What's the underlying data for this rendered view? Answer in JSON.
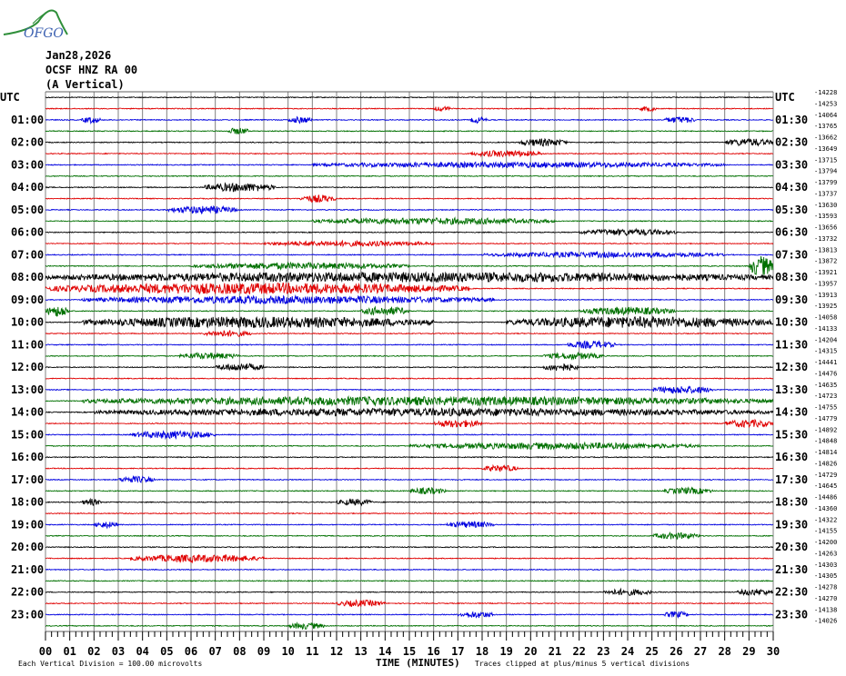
{
  "logo": {
    "text": "OFGO",
    "colors": {
      "hill": "#2f8f3a",
      "text": "#3a5fb0"
    }
  },
  "header": {
    "date": "Jan28,2026",
    "station": "OCSF HNZ RA 00",
    "component": "(A Vertical)",
    "tz_left": "UTC",
    "tz_right": "UTC"
  },
  "footer": {
    "scale": "Each Vertical Division = 100.00 microvolts",
    "xlabel": "TIME (MINUTES)",
    "note": "Traces clipped at plus/minus 5 vertical divisions"
  },
  "chart_data": {
    "type": "line",
    "subtype": "helicorder",
    "x_ticks": [
      "00",
      "01",
      "02",
      "03",
      "04",
      "05",
      "06",
      "07",
      "08",
      "09",
      "10",
      "11",
      "12",
      "13",
      "14",
      "15",
      "16",
      "17",
      "18",
      "19",
      "20",
      "21",
      "22",
      "23",
      "24",
      "25",
      "26",
      "27",
      "28",
      "29",
      "30"
    ],
    "xlim": [
      0,
      30
    ],
    "minor_ticks_per_minute": 4,
    "trace_color_cycle": [
      "#000000",
      "#e00000",
      "#0000e0",
      "#007000"
    ],
    "row_count": 48,
    "left_labels": [
      "UTC",
      "01:00",
      "02:00",
      "03:00",
      "04:00",
      "05:00",
      "06:00",
      "07:00",
      "08:00",
      "09:00",
      "10:00",
      "11:00",
      "12:00",
      "13:00",
      "14:00",
      "15:00",
      "16:00",
      "17:00",
      "18:00",
      "19:00",
      "20:00",
      "21:00",
      "22:00",
      "23:00"
    ],
    "right_labels": [
      "UTC",
      "01:30",
      "02:30",
      "03:30",
      "04:30",
      "05:30",
      "06:30",
      "07:30",
      "08:30",
      "09:30",
      "10:30",
      "11:30",
      "12:30",
      "13:30",
      "14:30",
      "15:30",
      "16:30",
      "17:30",
      "18:30",
      "19:30",
      "20:30",
      "21:30",
      "22:30",
      "23:30"
    ],
    "offsets": [
      "-14228",
      "-14253",
      "-14064",
      "-13765",
      "-13662",
      "-13649",
      "-13715",
      "-13794",
      "-13799",
      "-13737",
      "-13630",
      "-13593",
      "-13656",
      "-13732",
      "-13813",
      "-13872",
      "-13921",
      "-13957",
      "-13913",
      "-13925",
      "-14058",
      "-14133",
      "-14204",
      "-14315",
      "-14441",
      "-14476",
      "-14635",
      "-14723",
      "-14755",
      "-14779",
      "-14892",
      "-14848",
      "-14814",
      "-14826",
      "-14729",
      "-14645",
      "-14486",
      "-14360",
      "-14322",
      "-14155",
      "-14200",
      "-14263",
      "-14303",
      "-14305",
      "-14278",
      "-14270",
      "-14138",
      "-14026"
    ],
    "events": [
      {
        "row": 1,
        "start": 16.0,
        "end": 16.7,
        "amp": 0.25
      },
      {
        "row": 1,
        "start": 24.5,
        "end": 25.2,
        "amp": 0.25
      },
      {
        "row": 2,
        "start": 1.5,
        "end": 2.3,
        "amp": 0.3
      },
      {
        "row": 2,
        "start": 10.0,
        "end": 11.0,
        "amp": 0.3
      },
      {
        "row": 2,
        "start": 17.5,
        "end": 18.2,
        "amp": 0.3
      },
      {
        "row": 2,
        "start": 25.5,
        "end": 26.8,
        "amp": 0.3
      },
      {
        "row": 3,
        "start": 7.5,
        "end": 8.4,
        "amp": 0.3
      },
      {
        "row": 4,
        "start": 19.5,
        "end": 21.5,
        "amp": 0.35
      },
      {
        "row": 4,
        "start": 28.0,
        "end": 30.0,
        "amp": 0.35
      },
      {
        "row": 5,
        "start": 17.5,
        "end": 20.5,
        "amp": 0.3
      },
      {
        "row": 6,
        "start": 11.0,
        "end": 28.0,
        "amp": 0.25
      },
      {
        "row": 8,
        "start": 6.5,
        "end": 9.5,
        "amp": 0.4
      },
      {
        "row": 9,
        "start": 10.5,
        "end": 12.0,
        "amp": 0.35
      },
      {
        "row": 10,
        "start": 5.0,
        "end": 8.0,
        "amp": 0.35
      },
      {
        "row": 11,
        "start": 11.0,
        "end": 21.0,
        "amp": 0.3
      },
      {
        "row": 12,
        "start": 22.0,
        "end": 26.0,
        "amp": 0.3
      },
      {
        "row": 13,
        "start": 9.0,
        "end": 16.0,
        "amp": 0.25
      },
      {
        "row": 14,
        "start": 18.0,
        "end": 28.0,
        "amp": 0.25
      },
      {
        "row": 15,
        "start": 6.0,
        "end": 15.0,
        "amp": 0.3
      },
      {
        "row": 15,
        "start": 29.0,
        "end": 30.0,
        "amp": 0.9
      },
      {
        "row": 16,
        "start": 0.0,
        "end": 30.0,
        "amp": 0.45
      },
      {
        "row": 17,
        "start": 0.0,
        "end": 17.5,
        "amp": 0.5
      },
      {
        "row": 18,
        "start": 1.5,
        "end": 18.5,
        "amp": 0.35
      },
      {
        "row": 19,
        "start": 0.0,
        "end": 1.0,
        "amp": 0.5
      },
      {
        "row": 19,
        "start": 13.0,
        "end": 15.0,
        "amp": 0.4
      },
      {
        "row": 19,
        "start": 22.0,
        "end": 26.0,
        "amp": 0.35
      },
      {
        "row": 20,
        "start": 1.5,
        "end": 16.0,
        "amp": 0.5
      },
      {
        "row": 20,
        "start": 19.0,
        "end": 30.0,
        "amp": 0.5
      },
      {
        "row": 21,
        "start": 6.5,
        "end": 8.5,
        "amp": 0.3
      },
      {
        "row": 22,
        "start": 21.5,
        "end": 23.5,
        "amp": 0.35
      },
      {
        "row": 23,
        "start": 5.5,
        "end": 8.0,
        "amp": 0.3
      },
      {
        "row": 23,
        "start": 20.5,
        "end": 23.0,
        "amp": 0.3
      },
      {
        "row": 24,
        "start": 7.0,
        "end": 9.0,
        "amp": 0.35
      },
      {
        "row": 24,
        "start": 20.5,
        "end": 22.0,
        "amp": 0.35
      },
      {
        "row": 26,
        "start": 25.0,
        "end": 27.5,
        "amp": 0.35
      },
      {
        "row": 27,
        "start": 1.5,
        "end": 30.0,
        "amp": 0.4
      },
      {
        "row": 28,
        "start": 2.0,
        "end": 30.0,
        "amp": 0.35
      },
      {
        "row": 29,
        "start": 16.0,
        "end": 18.0,
        "amp": 0.35
      },
      {
        "row": 29,
        "start": 28.0,
        "end": 30.0,
        "amp": 0.35
      },
      {
        "row": 30,
        "start": 3.5,
        "end": 7.0,
        "amp": 0.35
      },
      {
        "row": 31,
        "start": 15.0,
        "end": 27.0,
        "amp": 0.3
      },
      {
        "row": 33,
        "start": 18.0,
        "end": 19.5,
        "amp": 0.3
      },
      {
        "row": 34,
        "start": 3.0,
        "end": 4.5,
        "amp": 0.3
      },
      {
        "row": 35,
        "start": 15.0,
        "end": 16.5,
        "amp": 0.3
      },
      {
        "row": 35,
        "start": 25.5,
        "end": 27.5,
        "amp": 0.3
      },
      {
        "row": 36,
        "start": 1.5,
        "end": 2.3,
        "amp": 0.3
      },
      {
        "row": 36,
        "start": 12.0,
        "end": 13.5,
        "amp": 0.3
      },
      {
        "row": 38,
        "start": 2.0,
        "end": 3.0,
        "amp": 0.3
      },
      {
        "row": 38,
        "start": 16.5,
        "end": 18.5,
        "amp": 0.3
      },
      {
        "row": 39,
        "start": 25.0,
        "end": 27.0,
        "amp": 0.3
      },
      {
        "row": 41,
        "start": 3.5,
        "end": 9.0,
        "amp": 0.35
      },
      {
        "row": 44,
        "start": 23.0,
        "end": 25.0,
        "amp": 0.3
      },
      {
        "row": 44,
        "start": 28.5,
        "end": 30.0,
        "amp": 0.3
      },
      {
        "row": 45,
        "start": 12.0,
        "end": 14.0,
        "amp": 0.3
      },
      {
        "row": 46,
        "start": 17.0,
        "end": 18.5,
        "amp": 0.3
      },
      {
        "row": 46,
        "start": 25.5,
        "end": 26.5,
        "amp": 0.3
      },
      {
        "row": 47,
        "start": 10.0,
        "end": 11.5,
        "amp": 0.3
      }
    ]
  }
}
